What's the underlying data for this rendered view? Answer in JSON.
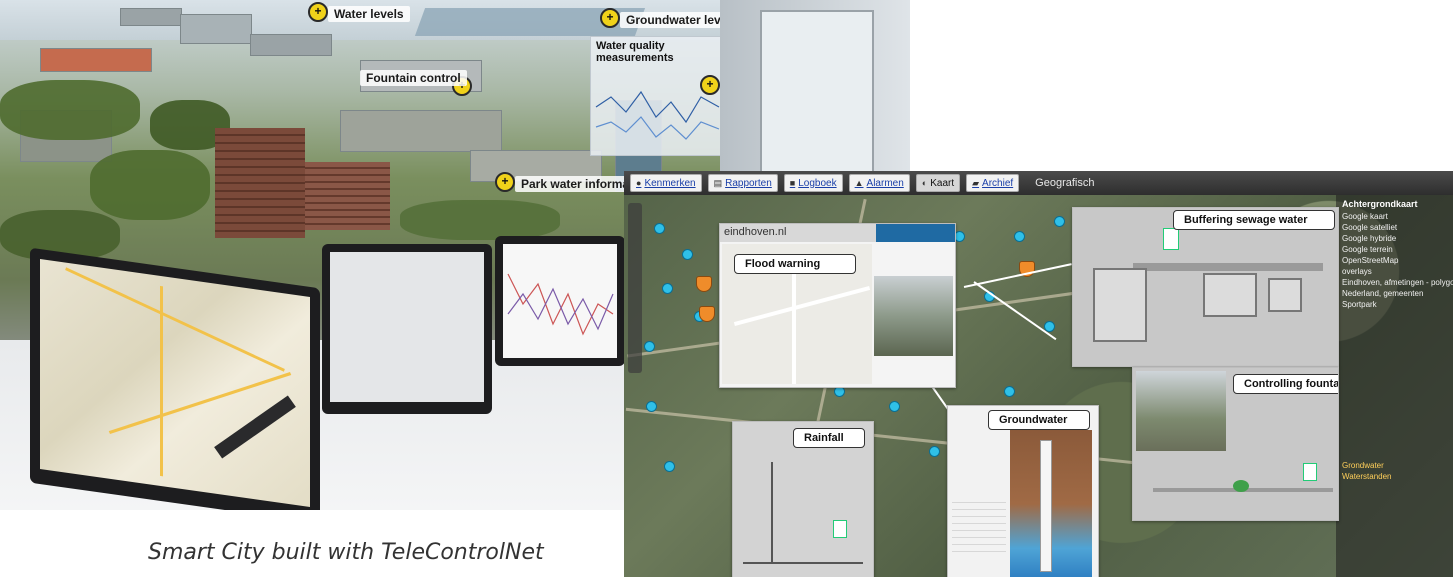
{
  "photo": {
    "ar_labels": [
      "Water levels",
      "Groundwater levels",
      "Water quality measurements",
      "Fountain control",
      "Park water information"
    ]
  },
  "caption": "Smart City built with TeleControlNet",
  "app": {
    "toolbar": {
      "buttons": [
        "Kenmerken",
        "Rapporten",
        "Logboek",
        "Alarmen",
        "Kaart",
        "Archief"
      ],
      "title": "Geografisch"
    },
    "layers": {
      "title": "Achtergrondkaart",
      "items": [
        "Google kaart",
        "Google satelliet",
        "Google hybride",
        "Google terrein",
        "OpenStreetMap",
        "overlays",
        "Eindhoven, afmetingen - polygo",
        "Nederland, gemeenten",
        "Sportpark",
        "Grondwater",
        "Waterstanden"
      ]
    },
    "popups": {
      "flood": {
        "title": "Flood warning",
        "header": "eindhoven.nl"
      },
      "sewage": {
        "title": "Buffering sewage water"
      },
      "fountains": {
        "title": "Controlling fountains"
      },
      "rainfall": {
        "title": "Rainfall"
      },
      "groundwater": {
        "title": "Groundwater"
      }
    }
  },
  "colors": {
    "accent_poi": "#2fc0e8",
    "accent_orange": "#ef8c2a",
    "pin_yellow": "#f0d21a"
  }
}
